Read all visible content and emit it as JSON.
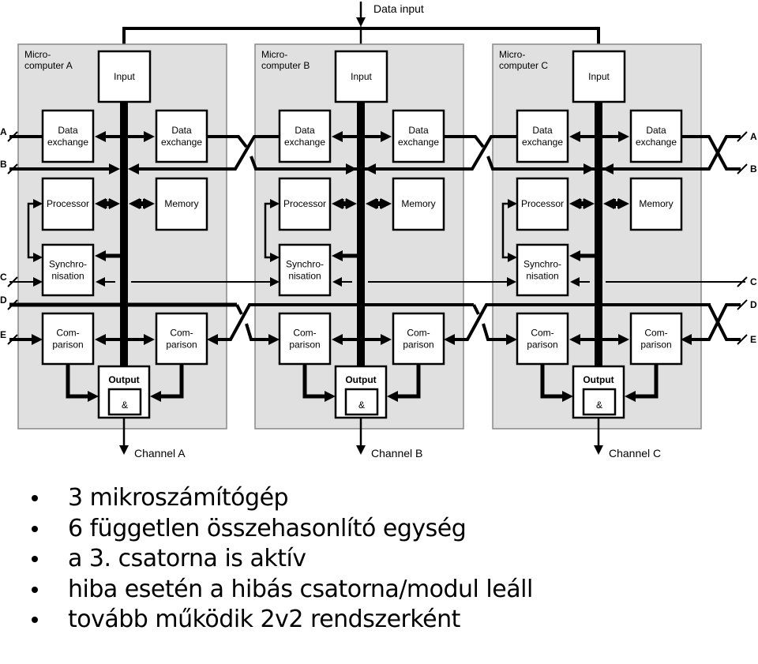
{
  "diagram": {
    "data_input_label": "Data input",
    "microcomputers": [
      {
        "name_line1": "Micro-",
        "name_line2": "computer A",
        "input": "Input",
        "data_exchange_left": [
          "Data",
          "exchange"
        ],
        "data_exchange_right": [
          "Data",
          "exchange"
        ],
        "processor": "Processor",
        "memory": "Memory",
        "synchronisation": [
          "Synchro-",
          "nisation"
        ],
        "comparison_left": [
          "Com-",
          "parison"
        ],
        "comparison_right": [
          "Com-",
          "parison"
        ],
        "output": "Output",
        "and_gate": "&",
        "channel": "Channel A"
      },
      {
        "name_line1": "Micro-",
        "name_line2": "computer B",
        "input": "Input",
        "data_exchange_left": [
          "Data",
          "exchange"
        ],
        "data_exchange_right": [
          "Data",
          "exchange"
        ],
        "processor": "Processor",
        "memory": "Memory",
        "synchronisation": [
          "Synchro-",
          "nisation"
        ],
        "comparison_left": [
          "Com-",
          "parison"
        ],
        "comparison_right": [
          "Com-",
          "parison"
        ],
        "output": "Output",
        "and_gate": "&",
        "channel": "Channel B"
      },
      {
        "name_line1": "Micro-",
        "name_line2": "computer C",
        "input": "Input",
        "data_exchange_left": [
          "Data",
          "exchange"
        ],
        "data_exchange_right": [
          "Data",
          "exchange"
        ],
        "processor": "Processor",
        "memory": "Memory",
        "synchronisation": [
          "Synchro-",
          "nisation"
        ],
        "comparison_left": [
          "Com-",
          "parison"
        ],
        "comparison_right": [
          "Com-",
          "parison"
        ],
        "output": "Output",
        "and_gate": "&",
        "channel": "Channel C"
      }
    ],
    "edge_labels_left": [
      "A",
      "B",
      "C",
      "D",
      "E"
    ],
    "edge_labels_right": [
      "A",
      "B",
      "C",
      "D",
      "E"
    ]
  },
  "bullets": [
    "3 mikroszámítógép",
    "6 független összehasonlító egység",
    "a 3. csatorna is aktív",
    "hiba esetén a hibás csatorna/modul leáll",
    "tovább működik 2v2 rendszerként"
  ]
}
